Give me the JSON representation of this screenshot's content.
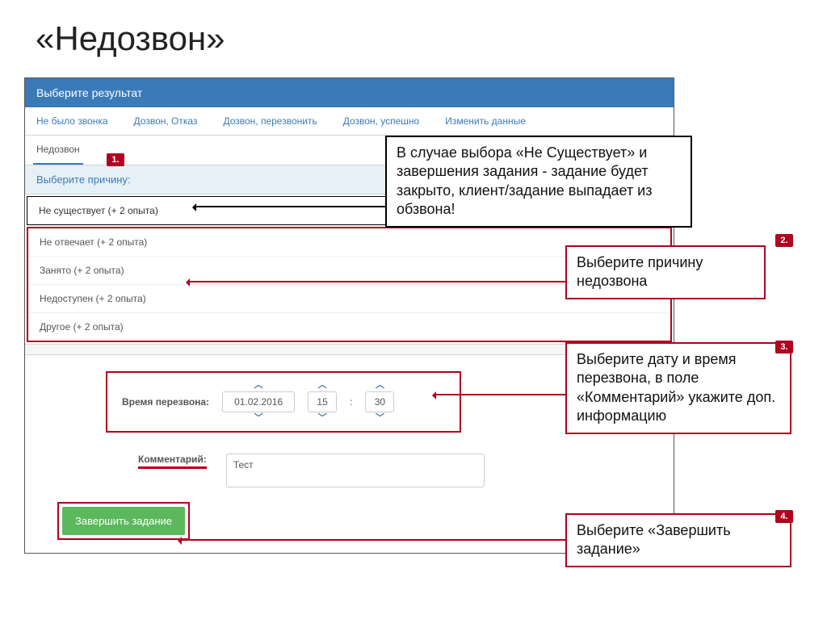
{
  "slide": {
    "title": "«Недозвон»"
  },
  "panel": {
    "header": "Выберите результат"
  },
  "tabs": {
    "items": [
      "Не было звонка",
      "Дозвон, Отказ",
      "Дозвон, перезвонить",
      "Дозвон, успешно",
      "Изменить данные"
    ],
    "active": "Недозвон"
  },
  "reason": {
    "header": "Выберите причину:",
    "items": [
      "Не существует (+ 2 опыта)",
      "Не отвечает (+ 2 опыта)",
      "Занято (+ 2 опыта)",
      "Недоступен (+ 2 опыта)",
      "Другое (+ 2 опыта)"
    ]
  },
  "callback": {
    "label": "Время перезвона:",
    "date": "01.02.2016",
    "hour": "15",
    "minute": "30"
  },
  "comment": {
    "label": "Комментарий:",
    "value": "Тест"
  },
  "finish": {
    "label": "Завершить задание"
  },
  "callouts": {
    "c1_badge": "1.",
    "c1_text": "В случае выбора «Не Существует» и завершения задания - задание будет закрыто, клиент/задание выпадает из обзвона!",
    "c2_badge": "2.",
    "c2_text": "Выберите причину недозвона",
    "c3_badge": "3.",
    "c3_text": "Выберите дату и время перезвона, в поле «Комментарий» укажите доп. информацию",
    "c4_badge": "4.",
    "c4_text": "Выберите «Завершить задание»"
  }
}
